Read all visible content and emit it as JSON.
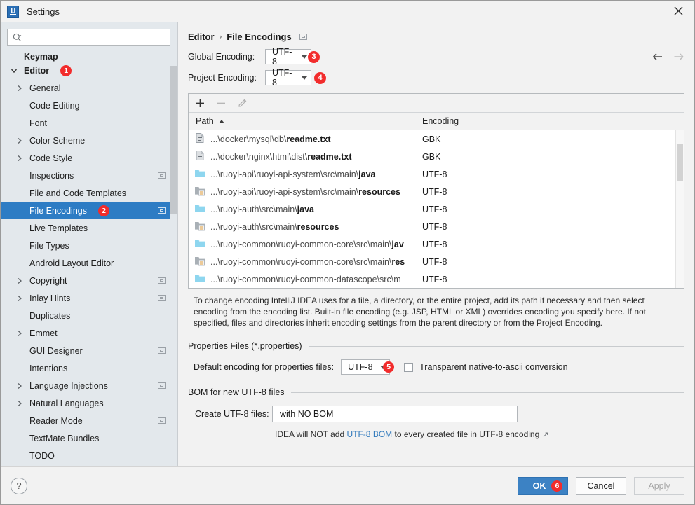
{
  "window": {
    "title": "Settings",
    "logo_text": "IJ",
    "close_icon": "close-icon"
  },
  "search": {
    "value": "",
    "placeholder": ""
  },
  "sidebar": {
    "items": [
      {
        "label": "Keymap",
        "indent": 0,
        "arrow": "none",
        "bold": true,
        "badge": "",
        "selected": false,
        "settings_square": false,
        "clipped": true
      },
      {
        "label": "Editor",
        "indent": 0,
        "arrow": "down",
        "bold": true,
        "badge": "1",
        "selected": false,
        "settings_square": false
      },
      {
        "label": "General",
        "indent": 1,
        "arrow": "right",
        "bold": false,
        "badge": "",
        "selected": false,
        "settings_square": false
      },
      {
        "label": "Code Editing",
        "indent": 1,
        "arrow": "none",
        "bold": false,
        "badge": "",
        "selected": false,
        "settings_square": false
      },
      {
        "label": "Font",
        "indent": 1,
        "arrow": "none",
        "bold": false,
        "badge": "",
        "selected": false,
        "settings_square": false
      },
      {
        "label": "Color Scheme",
        "indent": 1,
        "arrow": "right",
        "bold": false,
        "badge": "",
        "selected": false,
        "settings_square": false
      },
      {
        "label": "Code Style",
        "indent": 1,
        "arrow": "right",
        "bold": false,
        "badge": "",
        "selected": false,
        "settings_square": false
      },
      {
        "label": "Inspections",
        "indent": 1,
        "arrow": "none",
        "bold": false,
        "badge": "",
        "selected": false,
        "settings_square": true
      },
      {
        "label": "File and Code Templates",
        "indent": 1,
        "arrow": "none",
        "bold": false,
        "badge": "",
        "selected": false,
        "settings_square": false
      },
      {
        "label": "File Encodings",
        "indent": 1,
        "arrow": "none",
        "bold": false,
        "badge": "2",
        "selected": true,
        "settings_square": true
      },
      {
        "label": "Live Templates",
        "indent": 1,
        "arrow": "none",
        "bold": false,
        "badge": "",
        "selected": false,
        "settings_square": false
      },
      {
        "label": "File Types",
        "indent": 1,
        "arrow": "none",
        "bold": false,
        "badge": "",
        "selected": false,
        "settings_square": false
      },
      {
        "label": "Android Layout Editor",
        "indent": 1,
        "arrow": "none",
        "bold": false,
        "badge": "",
        "selected": false,
        "settings_square": false
      },
      {
        "label": "Copyright",
        "indent": 1,
        "arrow": "right",
        "bold": false,
        "badge": "",
        "selected": false,
        "settings_square": true
      },
      {
        "label": "Inlay Hints",
        "indent": 1,
        "arrow": "right",
        "bold": false,
        "badge": "",
        "selected": false,
        "settings_square": true
      },
      {
        "label": "Duplicates",
        "indent": 1,
        "arrow": "none",
        "bold": false,
        "badge": "",
        "selected": false,
        "settings_square": false
      },
      {
        "label": "Emmet",
        "indent": 1,
        "arrow": "right",
        "bold": false,
        "badge": "",
        "selected": false,
        "settings_square": false
      },
      {
        "label": "GUI Designer",
        "indent": 1,
        "arrow": "none",
        "bold": false,
        "badge": "",
        "selected": false,
        "settings_square": true
      },
      {
        "label": "Intentions",
        "indent": 1,
        "arrow": "none",
        "bold": false,
        "badge": "",
        "selected": false,
        "settings_square": false
      },
      {
        "label": "Language Injections",
        "indent": 1,
        "arrow": "right",
        "bold": false,
        "badge": "",
        "selected": false,
        "settings_square": true
      },
      {
        "label": "Natural Languages",
        "indent": 1,
        "arrow": "right",
        "bold": false,
        "badge": "",
        "selected": false,
        "settings_square": false
      },
      {
        "label": "Reader Mode",
        "indent": 1,
        "arrow": "none",
        "bold": false,
        "badge": "",
        "selected": false,
        "settings_square": true
      },
      {
        "label": "TextMate Bundles",
        "indent": 1,
        "arrow": "none",
        "bold": false,
        "badge": "",
        "selected": false,
        "settings_square": false
      },
      {
        "label": "TODO",
        "indent": 1,
        "arrow": "none",
        "bold": false,
        "badge": "",
        "selected": false,
        "settings_square": false
      }
    ]
  },
  "panel": {
    "breadcrumb": {
      "parent": "Editor",
      "separator": "›",
      "current": "File Encodings"
    },
    "nav": {
      "back_icon": "arrow-left-icon",
      "forward_icon": "arrow-right-icon"
    },
    "global_encoding": {
      "label": "Global Encoding:",
      "value": "UTF-8",
      "badge": "3"
    },
    "project_encoding": {
      "label": "Project Encoding:",
      "value": "UTF-8",
      "badge": "4"
    },
    "table": {
      "toolbar": {
        "add": "+",
        "remove": "−",
        "edit": "pencil-icon"
      },
      "columns": [
        "Path",
        "Encoding"
      ],
      "sort_column": "Path",
      "sort_direction": "asc",
      "rows": [
        {
          "icon": "txt-file-icon",
          "path_prefix": "...\\docker\\mysql\\db\\",
          "path_name": "readme.txt",
          "encoding": "GBK"
        },
        {
          "icon": "txt-file-icon",
          "path_prefix": "...\\docker\\nginx\\html\\dist\\",
          "path_name": "readme.txt",
          "encoding": "GBK"
        },
        {
          "icon": "source-folder-icon",
          "path_prefix": "...\\ruoyi-api\\ruoyi-api-system\\src\\main\\",
          "path_name": "java",
          "encoding": "UTF-8"
        },
        {
          "icon": "resource-folder-icon",
          "path_prefix": "...\\ruoyi-api\\ruoyi-api-system\\src\\main\\",
          "path_name": "resources",
          "encoding": "UTF-8"
        },
        {
          "icon": "source-folder-icon",
          "path_prefix": "...\\ruoyi-auth\\src\\main\\",
          "path_name": "java",
          "encoding": "UTF-8"
        },
        {
          "icon": "resource-folder-icon",
          "path_prefix": "...\\ruoyi-auth\\src\\main\\",
          "path_name": "resources",
          "encoding": "UTF-8"
        },
        {
          "icon": "source-folder-icon",
          "path_prefix": "...\\ruoyi-common\\ruoyi-common-core\\src\\main\\",
          "path_name": "jav",
          "encoding": "UTF-8"
        },
        {
          "icon": "resource-folder-icon",
          "path_prefix": "...\\ruoyi-common\\ruoyi-common-core\\src\\main\\",
          "path_name": "res",
          "encoding": "UTF-8"
        },
        {
          "icon": "source-folder-icon",
          "path_prefix": "...\\ruoyi-common\\ruoyi-common-datascope\\src\\m",
          "path_name": "",
          "encoding": "UTF-8"
        }
      ]
    },
    "description": "To change encoding IntelliJ IDEA uses for a file, a directory, or the entire project, add its path if necessary and then select encoding from the encoding list. Built-in file encoding (e.g. JSP, HTML or XML) overrides encoding you specify here. If not specified, files and directories inherit encoding settings from the parent directory or from the Project Encoding.",
    "properties_group": {
      "title": "Properties Files (*.properties)",
      "default_encoding_label": "Default encoding for properties files:",
      "default_encoding_value": "UTF-8",
      "badge": "5",
      "checkbox_label": "Transparent native-to-ascii conversion",
      "checkbox_checked": false
    },
    "bom_group": {
      "title": "BOM for new UTF-8 files",
      "create_label": "Create UTF-8 files:",
      "create_value": "with NO BOM",
      "hint_before": "IDEA will NOT add ",
      "hint_link": "UTF-8 BOM",
      "hint_after": " to every created file in UTF-8 encoding",
      "hint_external_icon": "↗"
    }
  },
  "footer": {
    "help": "?",
    "ok": "OK",
    "ok_badge": "6",
    "cancel": "Cancel",
    "apply": "Apply"
  },
  "colors": {
    "selection_blue": "#2d7cc4",
    "primary_button": "#3c82c4",
    "badge_red": "#f22c2c",
    "link_blue": "#337bbd",
    "sidebar_bg": "#e3e8ec",
    "panel_bg": "#f2f2f2"
  }
}
